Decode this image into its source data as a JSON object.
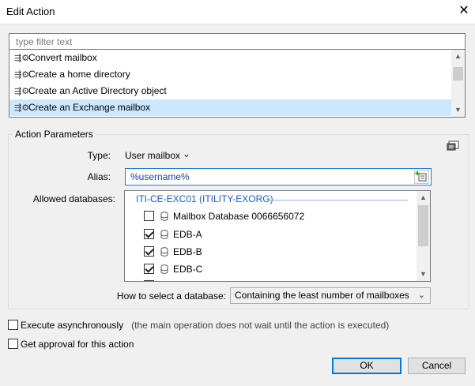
{
  "window": {
    "title": "Edit Action",
    "close_label": "✕"
  },
  "filter": {
    "placeholder": "type filter text",
    "value": ""
  },
  "action_list": {
    "items": [
      {
        "label": "Convert mailbox",
        "selected": false
      },
      {
        "label": "Create a home directory",
        "selected": false
      },
      {
        "label": "Create an Active Directory object",
        "selected": false
      },
      {
        "label": "Create an Exchange mailbox",
        "selected": true
      }
    ]
  },
  "params": {
    "group_title": "Action Parameters",
    "type_label": "Type:",
    "type_value": "User mailbox",
    "type_chevron": "⌄",
    "alias_label": "Alias:",
    "alias_value": "%username%",
    "allowed_label": "Allowed databases:",
    "db_group": "ITI-CE-EXC01 (ITILITY-EXORG)",
    "databases": [
      {
        "label": "Mailbox Database 0066656072",
        "checked": false
      },
      {
        "label": "EDB-A",
        "checked": true
      },
      {
        "label": "EDB-B",
        "checked": true
      },
      {
        "label": "EDB-C",
        "checked": true
      }
    ],
    "select_label": "How to select a database:",
    "select_value": "Containing the least number of mailboxes",
    "select_chevron": "⌄"
  },
  "options": {
    "async_label": "Execute asynchronously",
    "async_note": "(the main operation does not wait until the action is executed)",
    "async_checked": false,
    "approval_label": "Get approval for this action",
    "approval_checked": false
  },
  "buttons": {
    "ok": "OK",
    "cancel": "Cancel"
  },
  "colors": {
    "selection": "#cce8ff",
    "accent": "#0078d7",
    "link_text": "#1a5dbf"
  }
}
